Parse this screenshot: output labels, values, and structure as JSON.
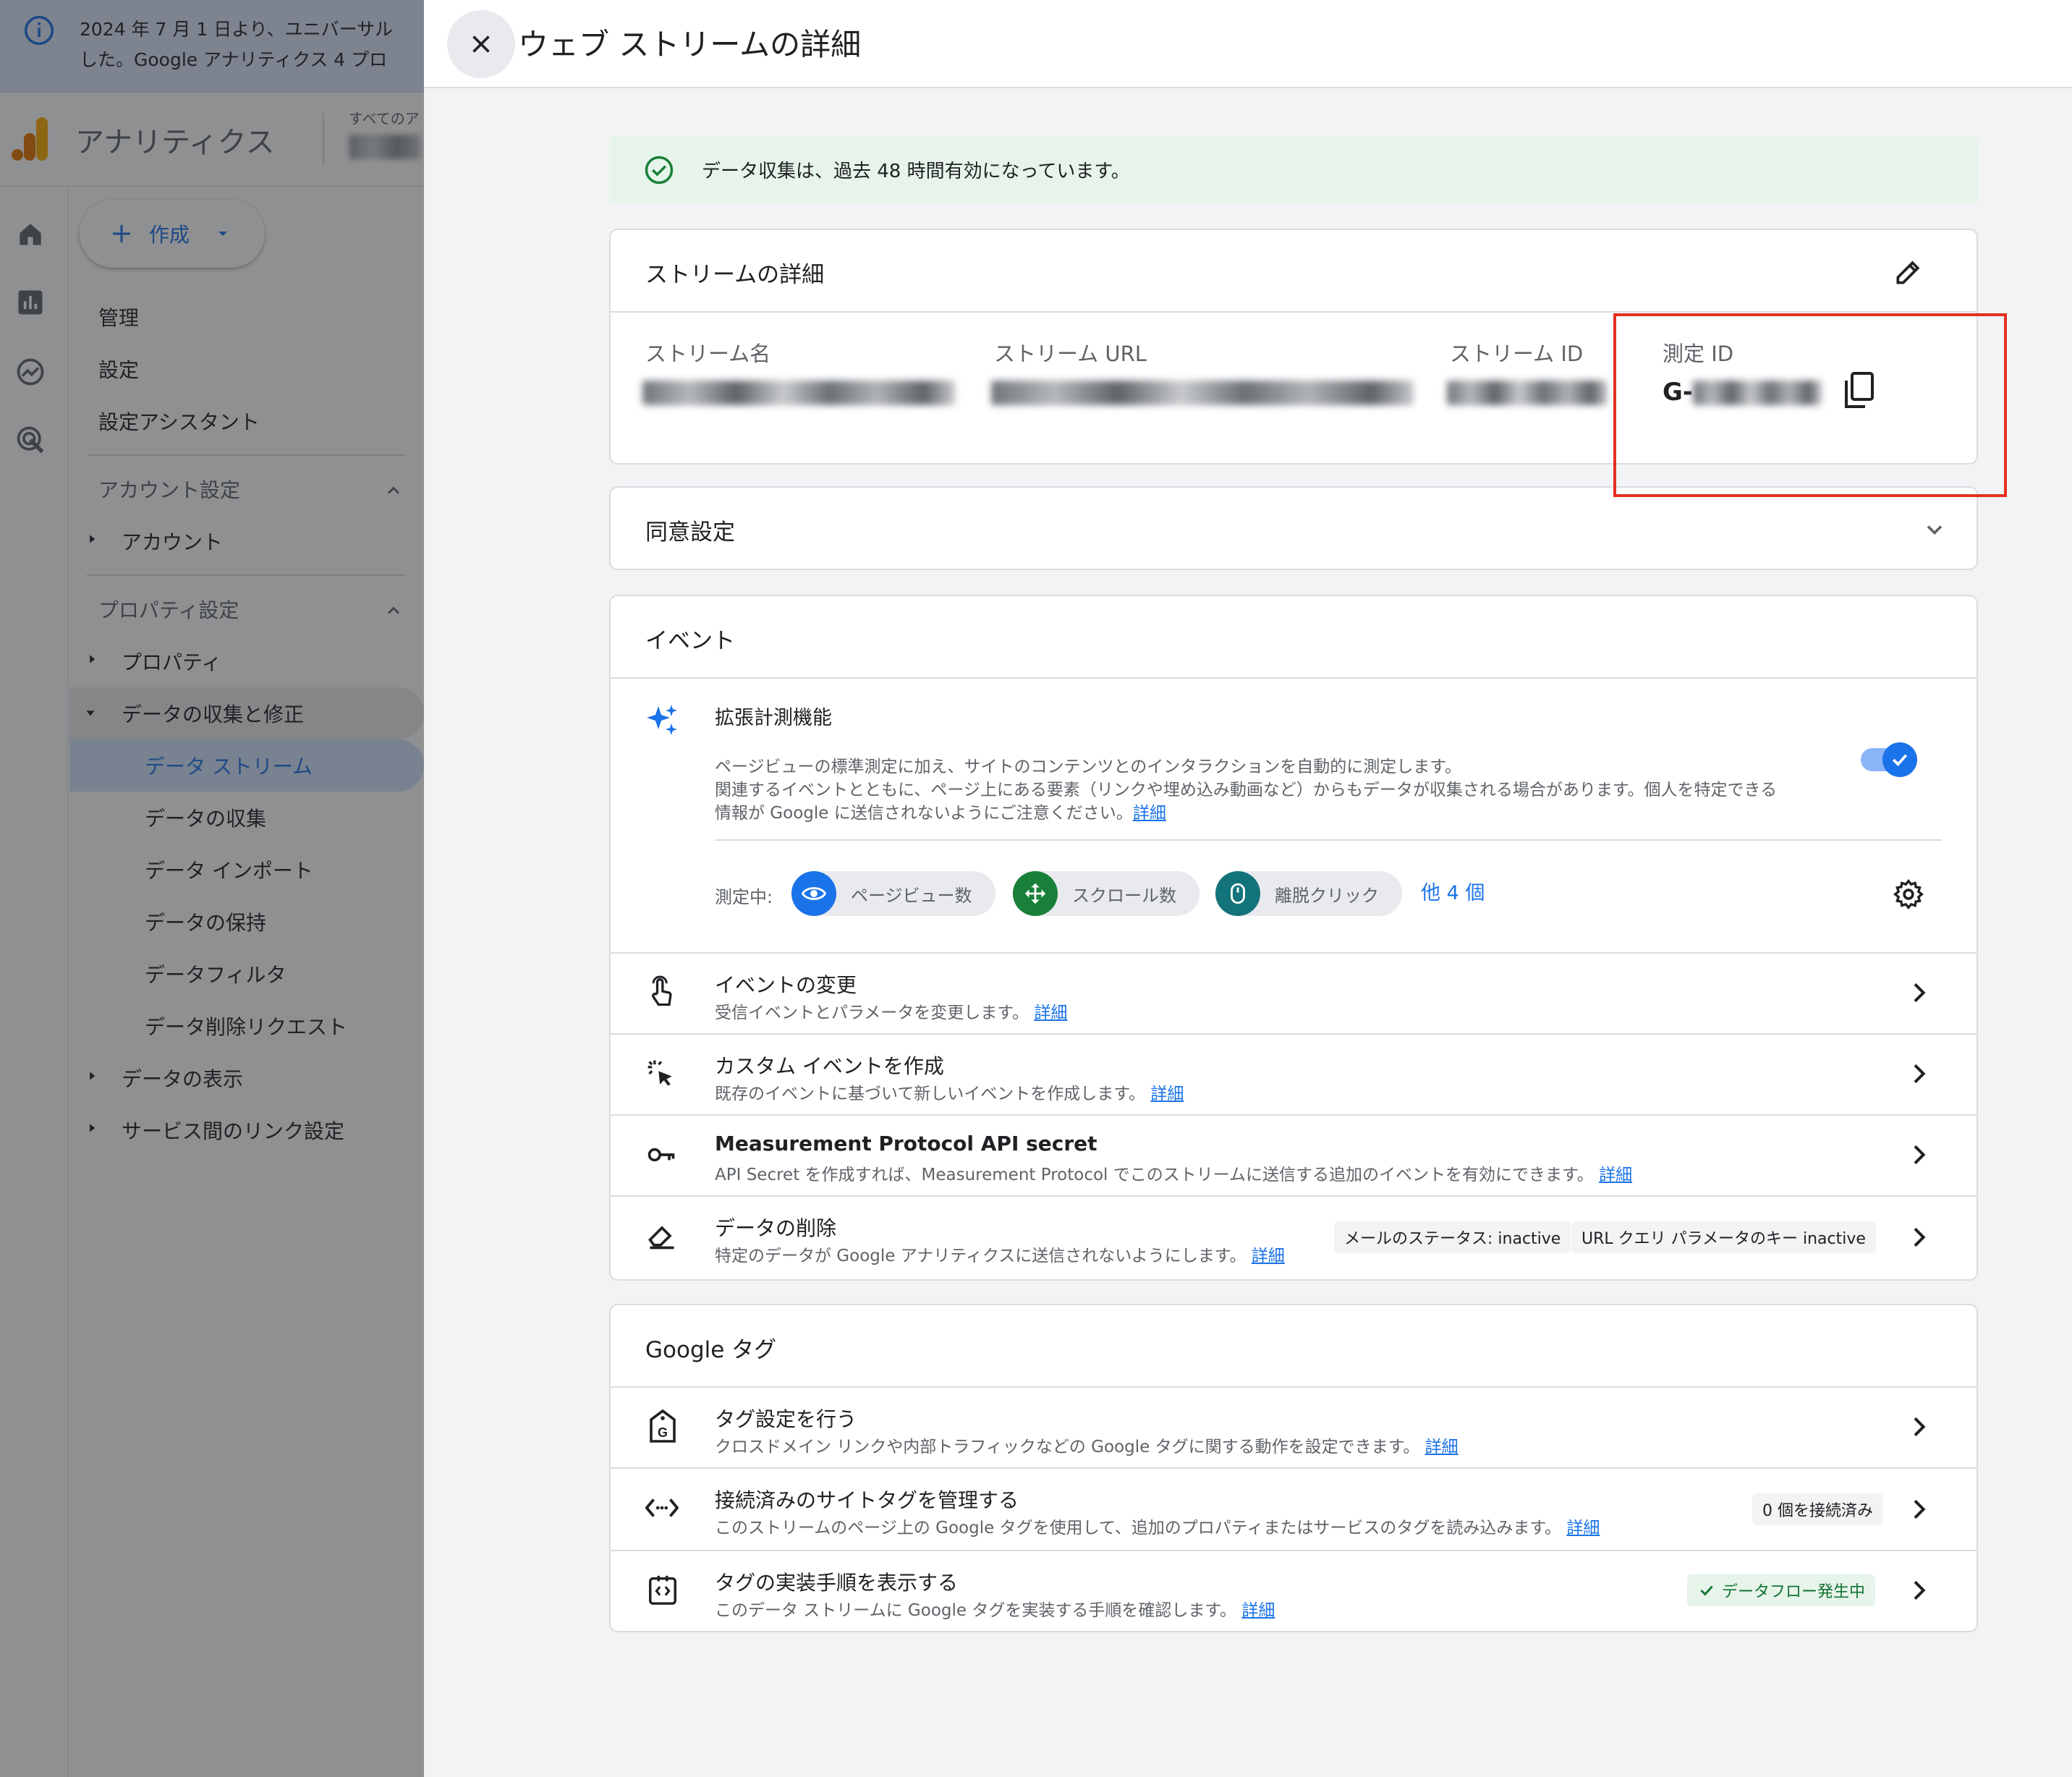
{
  "notice": {
    "text_line1": "2024 年 7 月 1 日より、ユニバーサル",
    "text_line2": "した。Google アナリティクス 4 プロ"
  },
  "app": {
    "title": "アナリティクス",
    "property_label": "すべてのア"
  },
  "sidebar": {
    "create_label": "作成",
    "top_items": [
      {
        "label": "管理"
      },
      {
        "label": "設定"
      },
      {
        "label": "設定アシスタント"
      }
    ],
    "account_section": "アカウント設定",
    "account_item": "アカウント",
    "property_section": "プロパティ設定",
    "property_item": "プロパティ",
    "data_collection": "データの収集と修正",
    "data_sub": [
      {
        "label": "データ ストリーム"
      },
      {
        "label": "データの収集"
      },
      {
        "label": "データ インポート"
      },
      {
        "label": "データの保持"
      },
      {
        "label": "データフィルタ"
      },
      {
        "label": "データ削除リクエスト"
      }
    ],
    "data_display": "データの表示",
    "service_links": "サービス間のリンク設定"
  },
  "panel": {
    "title": "ウェブ ストリームの詳細",
    "banner": "データ収集は、過去 48 時間有効になっています。",
    "stream_details": {
      "header": "ストリームの詳細",
      "name_label": "ストリーム名",
      "url_label": "ストリーム URL",
      "id_label": "ストリーム ID",
      "measurement_id_label": "測定 ID",
      "measurement_id_prefix": "G-"
    },
    "consent": {
      "header": "同意設定"
    },
    "events": {
      "header": "イベント",
      "enhanced": {
        "title": "拡張計測機能",
        "desc1": "ページビューの標準測定に加え、サイトのコンテンツとのインタラクションを自動的に測定します。",
        "desc2": "関連するイベントとともに、ページ上にある要素（リンクや埋め込み動画など）からもデータが収集される場合があります。個人を特定できる",
        "desc3": "情報が Google に送信されないようにご注意ください。",
        "link": "詳細",
        "measuring_label": "測定中:",
        "chips": [
          {
            "label": "ページビュー数",
            "color": "#1a73e8"
          },
          {
            "label": "スクロール数",
            "color": "#188038"
          },
          {
            "label": "離脱クリック",
            "color": "#12737a"
          }
        ],
        "more": "他 4 個",
        "toggle_on": true
      },
      "rows": [
        {
          "title": "イベントの変更",
          "desc": "受信イベントとパラメータを変更します。",
          "link": "詳細"
        },
        {
          "title": "カスタム イベントを作成",
          "desc": "既存のイベントに基づいて新しいイベントを作成します。",
          "link": "詳細"
        },
        {
          "title": "Measurement Protocol API secret",
          "desc": "API Secret を作成すれば、Measurement Protocol でこのストリームに送信する追加のイベントを有効にできます。",
          "link": "詳細"
        },
        {
          "title": "データの削除",
          "desc": "特定のデータが Google アナリティクスに送信されないようにします。",
          "link": "詳細",
          "pill1": "メールのステータス: inactive",
          "pill2": "URL クエリ パラメータのキー inactive"
        }
      ]
    },
    "google_tag": {
      "header": "Google タグ",
      "rows": [
        {
          "title": "タグ設定を行う",
          "desc": "クロスドメイン リンクや内部トラフィックなどの Google タグに関する動作を設定できます。",
          "link": "詳細"
        },
        {
          "title": "接続済みのサイトタグを管理する",
          "desc": "このストリームのページ上の Google タグを使用して、追加のプロパティまたはサービスのタグを読み込みます。",
          "link": "詳細",
          "badge": "0 個を接続済み"
        },
        {
          "title": "タグの実装手順を表示する",
          "desc": "このデータ ストリームに Google タグを実装する手順を確認します。",
          "link": "詳細",
          "badge": "データフロー発生中"
        }
      ]
    }
  }
}
